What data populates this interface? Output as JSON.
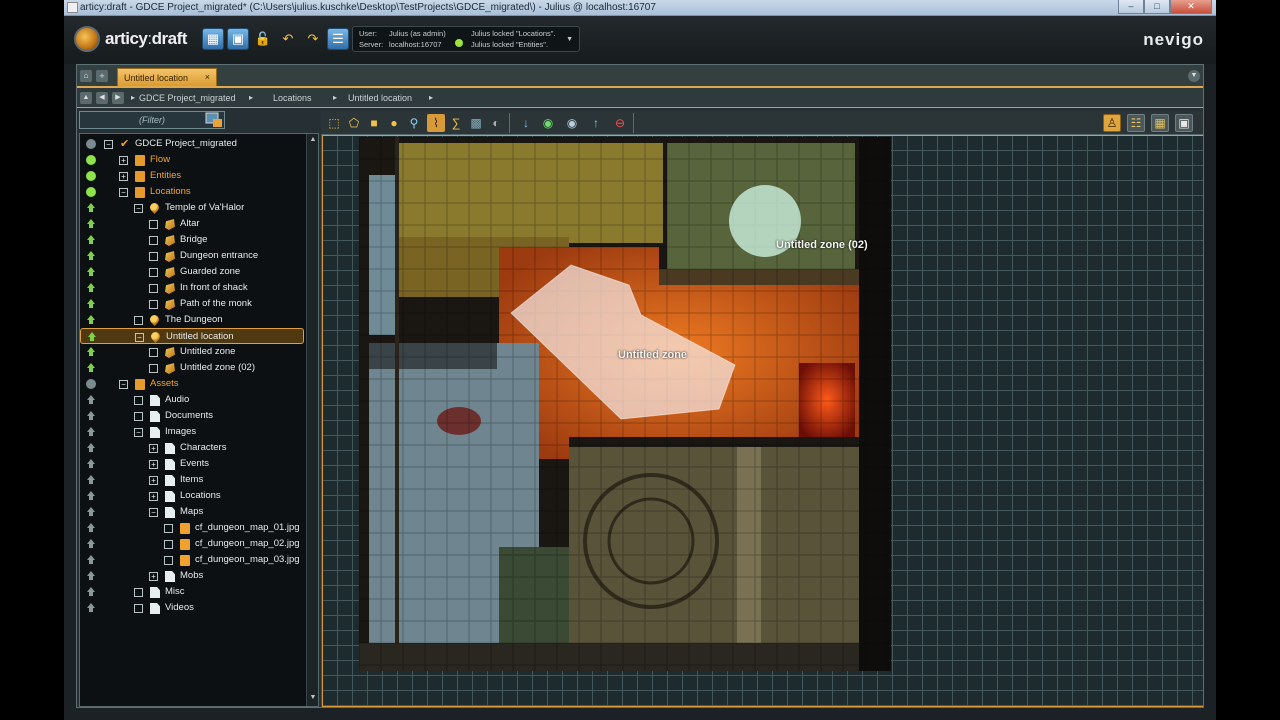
{
  "window": {
    "title": "articy:draft - GDCE Project_migrated* (C:\\Users\\julius.kuschke\\Desktop\\TestProjects\\GDCE_migrated\\) - Julius @ localhost:16707",
    "minimize": "–",
    "maximize": "□",
    "close": "✕"
  },
  "header": {
    "brand_main": "articy",
    "brand_sep": ":",
    "brand_sub": "draft",
    "user_label": "User:",
    "user_value": "Julius (as admin)",
    "server_label": "Server:",
    "server_value": "localhost:16707",
    "lock_line1": "Julius locked \"Locations\".",
    "lock_line2": "Julius locked \"Entities\".",
    "company": "nevigo",
    "status_color": "#9fe23a"
  },
  "tabs": {
    "active_label": "Untitled location",
    "close": "×"
  },
  "breadcrumb": [
    "GDCE Project_migrated",
    "Locations",
    "Untitled location"
  ],
  "filter": {
    "placeholder": "(Filter)"
  },
  "tree": [
    {
      "label": "GDCE Project_migrated",
      "status": "gray-dot",
      "icon": "root",
      "expander": "−",
      "level": 0,
      "style": "white"
    },
    {
      "label": "Flow",
      "status": "green-dot",
      "icon": "folder",
      "expander": "+",
      "level": 1,
      "style": "orange"
    },
    {
      "label": "Entities",
      "status": "green-dot",
      "icon": "folder",
      "expander": "+",
      "level": 1,
      "style": "orange"
    },
    {
      "label": "Locations",
      "status": "green-dot",
      "icon": "folder",
      "expander": "−",
      "level": 1,
      "style": "orange"
    },
    {
      "label": "Temple of Va'Halor",
      "status": "green-up",
      "icon": "pin",
      "expander": "−",
      "level": 2,
      "style": "white"
    },
    {
      "label": "Altar",
      "status": "green-up",
      "icon": "zone",
      "expander": "",
      "level": 3,
      "style": "white"
    },
    {
      "label": "Bridge",
      "status": "green-up",
      "icon": "zone",
      "expander": "",
      "level": 3,
      "style": "white"
    },
    {
      "label": "Dungeon entrance",
      "status": "green-up",
      "icon": "zone",
      "expander": "",
      "level": 3,
      "style": "white"
    },
    {
      "label": "Guarded zone",
      "status": "green-up",
      "icon": "zone",
      "expander": "",
      "level": 3,
      "style": "white"
    },
    {
      "label": "In front of shack",
      "status": "green-up",
      "icon": "zone",
      "expander": "",
      "level": 3,
      "style": "white"
    },
    {
      "label": "Path of the monk",
      "status": "green-up",
      "icon": "zone",
      "expander": "",
      "level": 3,
      "style": "white"
    },
    {
      "label": "The Dungeon",
      "status": "green-up",
      "icon": "pin",
      "expander": "",
      "level": 2,
      "style": "white"
    },
    {
      "label": "Untitled location",
      "status": "green-up",
      "icon": "pin",
      "expander": "−",
      "level": 2,
      "style": "white",
      "selected": true
    },
    {
      "label": "Untitled zone",
      "status": "green-up",
      "icon": "zone",
      "expander": "",
      "level": 3,
      "style": "white"
    },
    {
      "label": "Untitled zone (02)",
      "status": "green-up",
      "icon": "zone",
      "expander": "",
      "level": 3,
      "style": "white"
    },
    {
      "label": "Assets",
      "status": "gray-dot",
      "icon": "folder",
      "expander": "−",
      "level": 1,
      "style": "orange"
    },
    {
      "label": "Audio",
      "status": "gray-up",
      "icon": "page",
      "expander": "",
      "level": 2,
      "style": "white"
    },
    {
      "label": "Documents",
      "status": "gray-up",
      "icon": "page",
      "expander": "",
      "level": 2,
      "style": "white"
    },
    {
      "label": "Images",
      "status": "gray-up",
      "icon": "page",
      "expander": "−",
      "level": 2,
      "style": "white"
    },
    {
      "label": "Characters",
      "status": "gray-up",
      "icon": "page",
      "expander": "+",
      "level": 3,
      "style": "white"
    },
    {
      "label": "Events",
      "status": "gray-up",
      "icon": "page",
      "expander": "+",
      "level": 3,
      "style": "white"
    },
    {
      "label": "Items",
      "status": "gray-up",
      "icon": "page",
      "expander": "+",
      "level": 3,
      "style": "white"
    },
    {
      "label": "Locations",
      "status": "gray-up",
      "icon": "page",
      "expander": "+",
      "level": 3,
      "style": "white"
    },
    {
      "label": "Maps",
      "status": "gray-up",
      "icon": "page",
      "expander": "−",
      "level": 3,
      "style": "white"
    },
    {
      "label": "cf_dungeon_map_01.jpg",
      "status": "gray-up",
      "icon": "imgfile",
      "expander": "",
      "level": 4,
      "style": "white"
    },
    {
      "label": "cf_dungeon_map_02.jpg",
      "status": "gray-up",
      "icon": "imgfile",
      "expander": "",
      "level": 4,
      "style": "white"
    },
    {
      "label": "cf_dungeon_map_03.jpg",
      "status": "gray-up",
      "icon": "imgfile",
      "expander": "",
      "level": 4,
      "style": "white"
    },
    {
      "label": "Mobs",
      "status": "gray-up",
      "icon": "page",
      "expander": "+",
      "level": 3,
      "style": "white"
    },
    {
      "label": "Misc",
      "status": "gray-up",
      "icon": "page",
      "expander": "",
      "level": 2,
      "style": "white"
    },
    {
      "label": "Videos",
      "status": "gray-up",
      "icon": "page",
      "expander": "",
      "level": 2,
      "style": "white"
    }
  ],
  "map": {
    "zone1_label": "Untitled zone",
    "zone2_label": "Untitled zone (02)"
  },
  "toolbar_icons": {
    "left": [
      "select-tool-icon",
      "zone-tool-icon",
      "rectangle-tool-icon",
      "circle-tool-icon",
      "pin-tool-icon",
      "path-tool-icon",
      "spline-tool-icon",
      "image-tool-icon",
      "fill-tool-icon"
    ],
    "middle": [
      "send-backward-icon",
      "green-globe-icon",
      "blue-globe-icon",
      "bring-forward-icon",
      "delete-icon"
    ],
    "right": [
      "location-view-icon",
      "list-view-icon",
      "grid-view-icon",
      "map-view-icon"
    ]
  },
  "colors": {
    "accent": "#d89a38",
    "tab_bg": "#e8b24e",
    "selection": "#503810",
    "status_green": "#8ee34a"
  }
}
